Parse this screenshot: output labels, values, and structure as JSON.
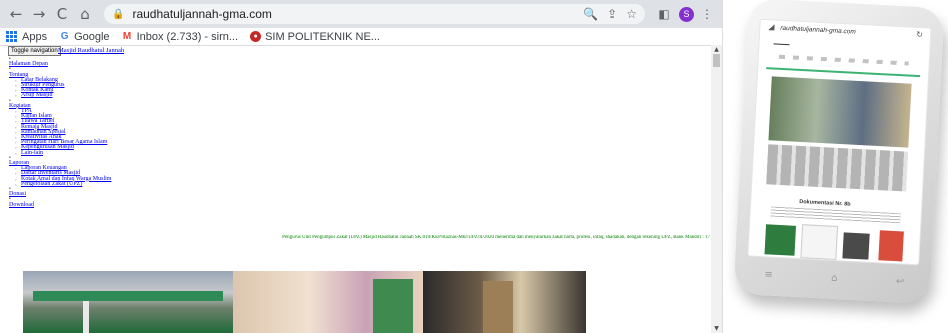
{
  "browser": {
    "url": "raudhatuljannah-gma.com",
    "nav": {
      "back": "←",
      "forward": "→",
      "reload": "C",
      "home": "⌂"
    },
    "profile_initial": "S",
    "bookmarks": [
      {
        "label": "Apps",
        "icon": "apps-grid-icon"
      },
      {
        "label": "Google",
        "icon": "google-icon"
      },
      {
        "label": "Inbox (2.733) - sirn...",
        "icon": "gmail-icon"
      },
      {
        "label": "SIM POLITEKNIK NE...",
        "icon": "sim-icon"
      }
    ]
  },
  "page": {
    "toggle_label": "Toggle navigation",
    "brand": "Masjid Raudhatul Jannah",
    "menu": [
      {
        "label": "Halaman Depan",
        "children": []
      },
      {
        "label": "Tentang",
        "children": [
          "Latar Belakang",
          "Struktur Pengurus",
          "Kontak Kami",
          "Arsip Masjid"
        ]
      },
      {
        "label": "Kegiatan",
        "children": [
          "TPA",
          "Kajian Islam",
          "Tilawa Tartiel",
          "Remaja Masjid",
          "Ramadhan Spesial",
          "Kreativitas Anak",
          "Peringatan Hari Besar Agama Islam",
          "Kepengurusan Masjid",
          "Lain-lain"
        ]
      },
      {
        "label": "Laporan",
        "children": [
          "Laporan Keuangan",
          "Daftar Inventaris Masjid",
          "Kotak Amal dan Infaq Warga Muslim",
          "Pengelolaan Zakat (UPZ)"
        ]
      },
      {
        "label": "Donasi",
        "children": []
      },
      {
        "label": "Download",
        "children": []
      }
    ],
    "marquee": "Pengurus Unit Pengumpul Zakat (UPZ) Masjid Raudhatul Jannah SK.010/KEP/Baznas-Mkr/UPZ/II/2020 menerima dan menyalurkan zakat harta, profesi, infaq, shadakah, dengan rekening UPZ, Bank Mandiri : 17"
  },
  "phone": {
    "url": "raudhatuljannah-gma.com",
    "section_title": "Dokumentasi Nr. 8b"
  },
  "colors": {
    "link": "#0000ee",
    "marquee": "#008000",
    "toolbar": "#dee1e6",
    "profile": "#8430ce"
  }
}
